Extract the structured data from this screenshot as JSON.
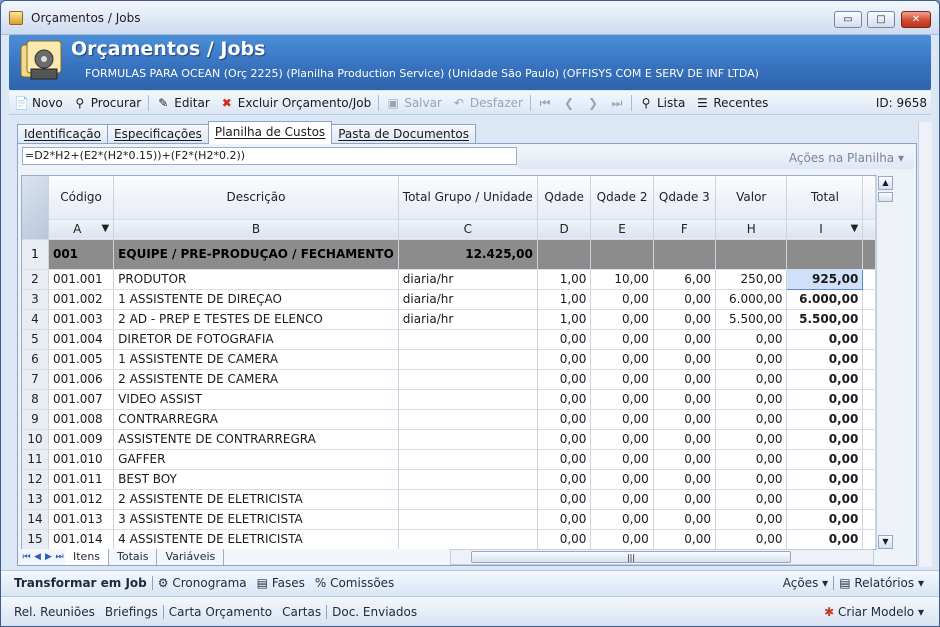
{
  "window": {
    "title": "Orçamentos / Jobs",
    "controls": {
      "minimize": "▭",
      "maximize": "□",
      "close": "✕"
    }
  },
  "header": {
    "title": "Orçamentos / Jobs",
    "subtitle": "FORMULAS PARA OCEAN (Orç 2225)  (Planilha Production Service) (Unidade São Paulo) (OFFISYS COM E SERV DE INF LTDA)"
  },
  "toolbar": {
    "novo": "Novo",
    "procurar": "Procurar",
    "editar": "Editar",
    "excluir": "Excluir Orçamento/Job",
    "salvar": "Salvar",
    "desfazer": "Desfazer",
    "lista": "Lista",
    "recentes": "Recentes",
    "id": "ID: 9658"
  },
  "tabs": [
    "Identificação",
    "Especificações",
    "Planilha de Custos",
    "Pasta de Documentos"
  ],
  "formula": "=D2*H2+(E2*(H2*0.15))+(F2*(H2*0.2))",
  "acoes_planilha": "Ações na Planilha ▾",
  "grid": {
    "headers": [
      "Código",
      "Descrição",
      "Total Grupo / Unidade",
      "Qdade",
      "Qdade 2",
      "Qdade 3",
      "Valor",
      "Total"
    ],
    "letters": [
      "A",
      "B",
      "C",
      "D",
      "E",
      "F",
      "H",
      "I"
    ],
    "group_row": {
      "n": "1",
      "codigo": "001",
      "descricao": "EQUIPE / PRE-PRODUÇAO / FECHAMENTO",
      "total": "12.425,00"
    },
    "rows": [
      {
        "n": "2",
        "codigo": "001.001",
        "descricao": "PRODUTOR",
        "unidade": "diaria/hr",
        "qdade": "1,00",
        "qdade2": "10,00",
        "qdade3": "6,00",
        "valor": "250,00",
        "total": "925,00"
      },
      {
        "n": "3",
        "codigo": "001.002",
        "descricao": "1 ASSISTENTE DE DIREÇAO",
        "unidade": "diaria/hr",
        "qdade": "1,00",
        "qdade2": "0,00",
        "qdade3": "0,00",
        "valor": "6.000,00",
        "total": "6.000,00"
      },
      {
        "n": "4",
        "codigo": "001.003",
        "descricao": "2 AD - PREP E TESTES DE ELENCO",
        "unidade": "diaria/hr",
        "qdade": "1,00",
        "qdade2": "0,00",
        "qdade3": "0,00",
        "valor": "5.500,00",
        "total": "5.500,00"
      },
      {
        "n": "5",
        "codigo": "001.004",
        "descricao": "DIRETOR DE FOTOGRAFIA",
        "unidade": "",
        "qdade": "0,00",
        "qdade2": "0,00",
        "qdade3": "0,00",
        "valor": "0,00",
        "total": "0,00"
      },
      {
        "n": "6",
        "codigo": "001.005",
        "descricao": "1 ASSISTENTE DE CAMERA",
        "unidade": "",
        "qdade": "0,00",
        "qdade2": "0,00",
        "qdade3": "0,00",
        "valor": "0,00",
        "total": "0,00"
      },
      {
        "n": "7",
        "codigo": "001.006",
        "descricao": "2 ASSISTENTE DE CAMERA",
        "unidade": "",
        "qdade": "0,00",
        "qdade2": "0,00",
        "qdade3": "0,00",
        "valor": "0,00",
        "total": "0,00"
      },
      {
        "n": "8",
        "codigo": "001.007",
        "descricao": "VIDEO ASSIST",
        "unidade": "",
        "qdade": "0,00",
        "qdade2": "0,00",
        "qdade3": "0,00",
        "valor": "0,00",
        "total": "0,00"
      },
      {
        "n": "9",
        "codigo": "001.008",
        "descricao": "CONTRARREGRA",
        "unidade": "",
        "qdade": "0,00",
        "qdade2": "0,00",
        "qdade3": "0,00",
        "valor": "0,00",
        "total": "0,00"
      },
      {
        "n": "10",
        "codigo": "001.009",
        "descricao": "ASSISTENTE DE CONTRARREGRA",
        "unidade": "",
        "qdade": "0,00",
        "qdade2": "0,00",
        "qdade3": "0,00",
        "valor": "0,00",
        "total": "0,00"
      },
      {
        "n": "11",
        "codigo": "001.010",
        "descricao": "GAFFER",
        "unidade": "",
        "qdade": "0,00",
        "qdade2": "0,00",
        "qdade3": "0,00",
        "valor": "0,00",
        "total": "0,00"
      },
      {
        "n": "12",
        "codigo": "001.011",
        "descricao": "BEST BOY",
        "unidade": "",
        "qdade": "0,00",
        "qdade2": "0,00",
        "qdade3": "0,00",
        "valor": "0,00",
        "total": "0,00"
      },
      {
        "n": "13",
        "codigo": "001.012",
        "descricao": "2 ASSISTENTE DE ELETRICISTA",
        "unidade": "",
        "qdade": "0,00",
        "qdade2": "0,00",
        "qdade3": "0,00",
        "valor": "0,00",
        "total": "0,00"
      },
      {
        "n": "14",
        "codigo": "001.013",
        "descricao": "3 ASSISTENTE DE ELETRICISTA",
        "unidade": "",
        "qdade": "0,00",
        "qdade2": "0,00",
        "qdade3": "0,00",
        "valor": "0,00",
        "total": "0,00"
      },
      {
        "n": "15",
        "codigo": "001.014",
        "descricao": "4 ASSISTENTE DE ELETRICISTA",
        "unidade": "",
        "qdade": "0,00",
        "qdade2": "0,00",
        "qdade3": "0,00",
        "valor": "0,00",
        "total": "0,00"
      }
    ]
  },
  "sheet_tabs": [
    "Itens",
    "Totais",
    "Variáveis"
  ],
  "bottom1": {
    "transformar": "Transformar em Job",
    "cronograma": "Cronograma",
    "fases": "Fases",
    "comissoes": "Comissões",
    "acoes": "Ações ▾",
    "relatorios": "Relatórios ▾"
  },
  "bottom2": {
    "links": [
      "Rel. Reuniões",
      "Briefings",
      "Carta Orçamento",
      "Cartas",
      "Doc. Enviados"
    ],
    "criar_modelo": "Criar Modelo ▾"
  },
  "colors": {
    "header_blue": "#3873c0",
    "group_row": "#8c8c8c",
    "selected_cell": "#cfe0f8"
  }
}
